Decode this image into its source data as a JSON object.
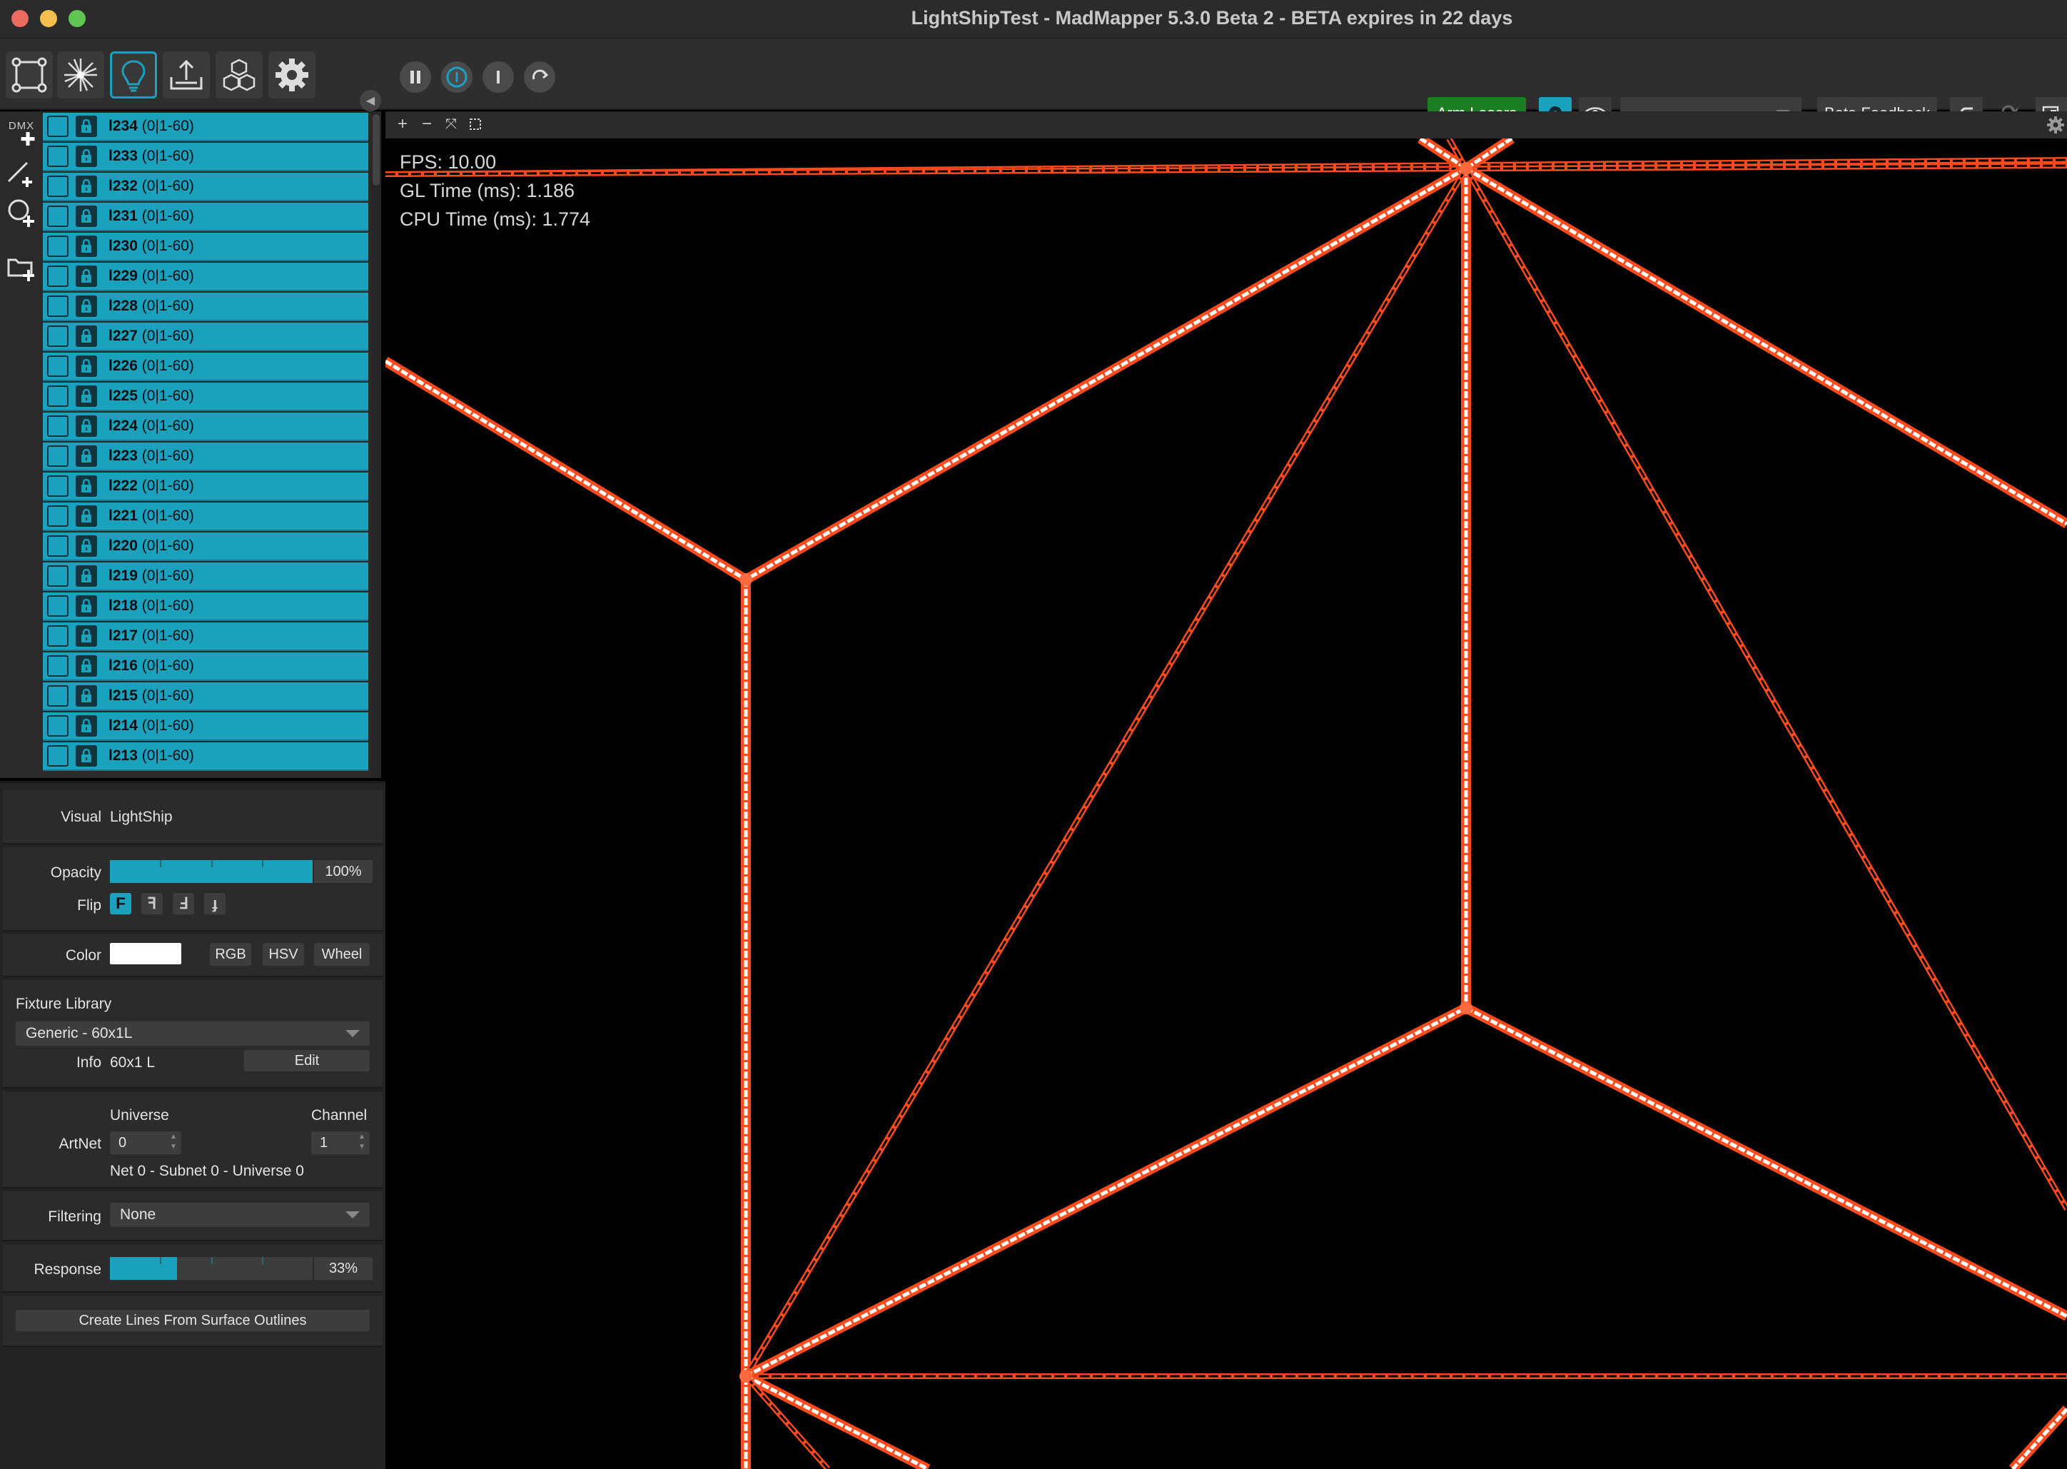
{
  "window": {
    "title": "LightShipTest - MadMapper 5.3.0 Beta 2 - BETA expires in 22 days"
  },
  "toolbar": {
    "tools": [
      {
        "name": "surface-tool",
        "icon": "bezier-square-icon"
      },
      {
        "name": "laser-tool",
        "icon": "laser-burst-icon"
      },
      {
        "name": "fixture-tool",
        "icon": "lightbulb-icon",
        "active": true
      },
      {
        "name": "output-tool",
        "icon": "output-tray-icon"
      },
      {
        "name": "media-tool",
        "icon": "cubes-icon"
      },
      {
        "name": "settings-tool",
        "icon": "gear-icon"
      }
    ],
    "transport": [
      "pause-icon",
      "play-circle-icon",
      "stop-icon",
      "loop-icon"
    ],
    "arm_lasers": "Arm Lasers",
    "beta_feedback": "Beta Feedback",
    "dropdown_value": "",
    "colors": {
      "accent": "#1aa1bd",
      "arm": "#1b7e22"
    }
  },
  "sidestrip": {
    "dmx_label": "DMX",
    "tools": [
      "add-dmx-icon",
      "add-line-icon",
      "add-circle-icon",
      "add-folder-icon"
    ]
  },
  "fixtures": [
    {
      "name": "l234",
      "range": "(0|1-60)"
    },
    {
      "name": "l233",
      "range": "(0|1-60)"
    },
    {
      "name": "l232",
      "range": "(0|1-60)"
    },
    {
      "name": "l231",
      "range": "(0|1-60)"
    },
    {
      "name": "l230",
      "range": "(0|1-60)"
    },
    {
      "name": "l229",
      "range": "(0|1-60)"
    },
    {
      "name": "l228",
      "range": "(0|1-60)"
    },
    {
      "name": "l227",
      "range": "(0|1-60)"
    },
    {
      "name": "l226",
      "range": "(0|1-60)"
    },
    {
      "name": "l225",
      "range": "(0|1-60)"
    },
    {
      "name": "l224",
      "range": "(0|1-60)"
    },
    {
      "name": "l223",
      "range": "(0|1-60)"
    },
    {
      "name": "l222",
      "range": "(0|1-60)"
    },
    {
      "name": "l221",
      "range": "(0|1-60)"
    },
    {
      "name": "l220",
      "range": "(0|1-60)"
    },
    {
      "name": "l219",
      "range": "(0|1-60)"
    },
    {
      "name": "l218",
      "range": "(0|1-60)"
    },
    {
      "name": "l217",
      "range": "(0|1-60)"
    },
    {
      "name": "l216",
      "range": "(0|1-60)"
    },
    {
      "name": "l215",
      "range": "(0|1-60)"
    },
    {
      "name": "l214",
      "range": "(0|1-60)"
    },
    {
      "name": "l213",
      "range": "(0|1-60)"
    }
  ],
  "props": {
    "visual": {
      "label": "Visual",
      "value": "LightShip"
    },
    "opacity": {
      "label": "Opacity",
      "value": "100%",
      "level": 1.0
    },
    "flip": {
      "label": "Flip",
      "buttons": [
        "F",
        "ꟻ",
        "Ⅎ",
        "ɟ"
      ]
    },
    "color": {
      "label": "Color",
      "swatch": "#ffffff",
      "modes": [
        "RGB",
        "HSV",
        "Wheel"
      ]
    },
    "fixture_library": {
      "label": "Fixture Library",
      "value": "Generic - 60x1L"
    },
    "info": {
      "label": "Info",
      "value": "60x1 L",
      "edit": "Edit"
    },
    "artnet": {
      "label": "ArtNet",
      "universe_label": "Universe",
      "channel_label": "Channel",
      "universe": "0",
      "channel": "1",
      "summary": "Net 0 - Subnet 0 - Universe 0"
    },
    "filtering": {
      "label": "Filtering",
      "value": "None"
    },
    "response": {
      "label": "Response",
      "value": "33%",
      "level": 0.33
    },
    "create_lines": "Create Lines From Surface Outlines"
  },
  "viewport": {
    "stats": {
      "fps": "FPS: 10.00",
      "gl": "GL Time (ms): 1.186",
      "cpu": "CPU Time (ms): 1.774"
    },
    "tools": [
      "zoom-in-icon",
      "zoom-out-icon",
      "fit-icon",
      "select-rect-icon"
    ],
    "line_color": "#ff4a1c"
  }
}
